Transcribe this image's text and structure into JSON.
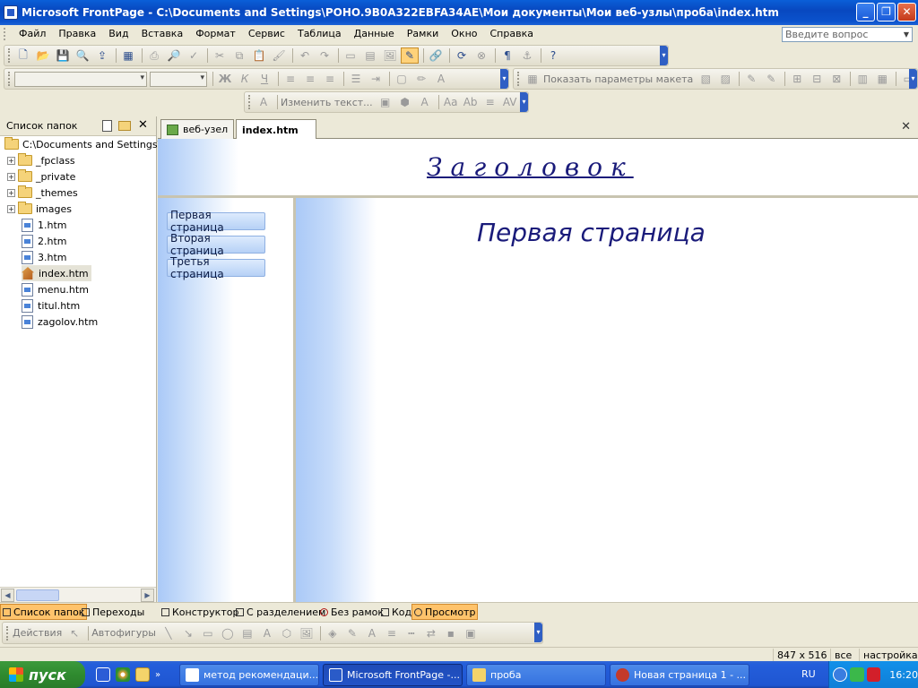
{
  "window": {
    "title": "Microsoft FrontPage - C:\\Documents and Settings\\POHO.9B0A322EBFA34AE\\Мои документы\\Мои веб-узлы\\проба\\index.htm",
    "minimize": "_",
    "maximize": "❐",
    "close": "✕"
  },
  "menu": {
    "items": [
      "Файл",
      "Правка",
      "Вид",
      "Вставка",
      "Формат",
      "Сервис",
      "Таблица",
      "Данные",
      "Рамки",
      "Окно",
      "Справка"
    ],
    "ask_placeholder": "Введите вопрос"
  },
  "formatting": {
    "show_layout": "Показать параметры макета"
  },
  "picture_toolbar": {
    "edit_text": "Изменить текст..."
  },
  "folder_panel": {
    "title": "Список папок",
    "root": "C:\\Documents and Settings\\PC",
    "folders": [
      "_fpclass",
      "_private",
      "_themes",
      "images"
    ],
    "files": [
      "1.htm",
      "2.htm",
      "3.htm",
      "index.htm",
      "menu.htm",
      "titul.htm",
      "zagolov.htm"
    ],
    "selected": "index.htm"
  },
  "tabs": [
    "веб-узел",
    "index.htm"
  ],
  "page": {
    "header": "Заголовок",
    "nav": [
      "Первая страница",
      "Вторая страница",
      "Третья страница"
    ],
    "main_title": "Первая страница"
  },
  "panel_views": [
    "Список папок",
    "Переходы"
  ],
  "view_modes": [
    "Конструктор",
    "С разделением",
    "Без рамок",
    "Код",
    "Просмотр"
  ],
  "active_view": "Просмотр",
  "drawing": {
    "actions": "Действия",
    "autoshapes": "Автофигуры"
  },
  "status": {
    "size": "847 x 516",
    "all": "все",
    "settings": "настройка"
  },
  "taskbar": {
    "start": "пуск",
    "tasks": [
      "метод рекомендаци...",
      "Microsoft FrontPage -...",
      "проба",
      "Новая страница 1 - ..."
    ],
    "lang": "RU",
    "clock": "16:20"
  },
  "colors": {
    "title_blue": "#0848c0",
    "frame_gradient": "#aac9f7",
    "heading": "#1a1b7a",
    "active_view": "#ffc36b"
  }
}
